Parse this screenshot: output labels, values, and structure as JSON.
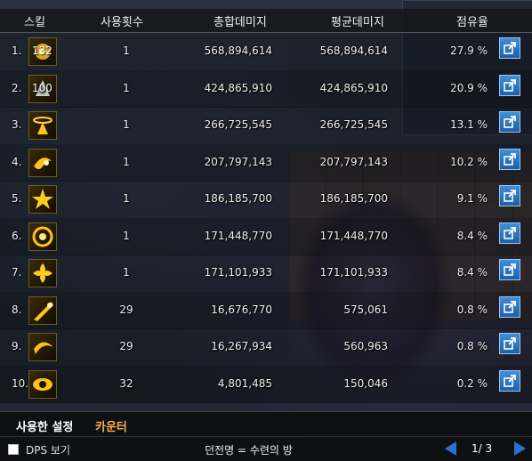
{
  "header": {
    "skill": "스킬",
    "count": "사용횟수",
    "total": "총합데미지",
    "avg": "평균데미지",
    "share": "점유율"
  },
  "rows": [
    {
      "index": "1.",
      "level": "132",
      "icon": "skill-icon-1",
      "count": "1",
      "total": "568,894,614",
      "avg": "568,894,614",
      "share": "27.9 %"
    },
    {
      "index": "2.",
      "level": "100",
      "icon": "skill-icon-2",
      "count": "1",
      "total": "424,865,910",
      "avg": "424,865,910",
      "share": "20.9 %"
    },
    {
      "index": "3.",
      "level": "",
      "icon": "halo-skill-icon",
      "count": "1",
      "total": "266,725,545",
      "avg": "266,725,545",
      "share": "13.1 %"
    },
    {
      "index": "4.",
      "level": "",
      "icon": "swirl-skill-icon",
      "count": "1",
      "total": "207,797,143",
      "avg": "207,797,143",
      "share": "10.2 %"
    },
    {
      "index": "5.",
      "level": "",
      "icon": "starburst-skill-icon",
      "count": "1",
      "total": "186,185,700",
      "avg": "186,185,700",
      "share": "9.1 %"
    },
    {
      "index": "6.",
      "level": "",
      "icon": "vortex-skill-icon",
      "count": "1",
      "total": "171,448,770",
      "avg": "171,448,770",
      "share": "8.4 %"
    },
    {
      "index": "7.",
      "level": "",
      "icon": "flower-skill-icon",
      "count": "1",
      "total": "171,101,933",
      "avg": "171,101,933",
      "share": "8.4 %"
    },
    {
      "index": "8.",
      "level": "",
      "icon": "strike-skill-icon",
      "count": "29",
      "total": "16,676,770",
      "avg": "575,061",
      "share": "0.8 %"
    },
    {
      "index": "9.",
      "level": "",
      "icon": "crescent-skill-icon",
      "count": "29",
      "total": "16,267,934",
      "avg": "560,963",
      "share": "0.8 %"
    },
    {
      "index": "10.",
      "level": "",
      "icon": "eye-skill-icon",
      "count": "32",
      "total": "4,801,485",
      "avg": "150,046",
      "share": "0.2 %"
    }
  ],
  "tabs": [
    {
      "label": "사용한 설정",
      "active": true
    },
    {
      "label": "카운터",
      "active": false
    }
  ],
  "status": {
    "dps_label": "DPS 보기",
    "dungeon": "던전명 = 수련의 방",
    "page": "1/ 3"
  },
  "colors": {
    "tab_inactive": "#ffb347",
    "export_button": "#2f7fd0",
    "pager_arrow": "#2b6fd0"
  }
}
